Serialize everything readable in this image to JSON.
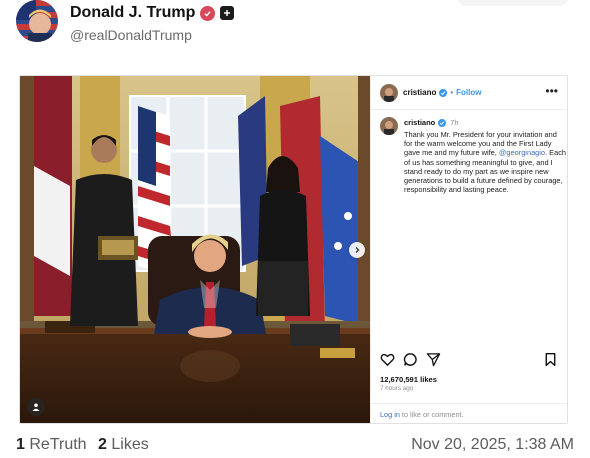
{
  "post": {
    "display_name": "Donald J. Trump",
    "handle": "@realDonaldTrump",
    "verified_icon": "verified-badge-icon",
    "extra_icon": "plus-square-icon"
  },
  "embed": {
    "username": "cristiano",
    "follow_label": "Follow",
    "dot": "•",
    "more_label": "•••",
    "caption_user": "cristiano",
    "caption_time": "7h",
    "caption_text_before": "Thank you Mr. President for your invitation and for the warm welcome you and the First Lady gave me and my future wife, ",
    "caption_mention": "@georginagio",
    "caption_text_after": ". Each of us has something meaningful to give, and I stand ready to do my part as we inspire new generations to build a future defined by courage, responsibility and lasting peace.",
    "likes": "12,670,591 likes",
    "time_ago": "7 hours ago",
    "login_link": "Log in",
    "login_rest": " to like or comment."
  },
  "footer": {
    "retruth_count": "1",
    "retruth_label": "ReTruth",
    "likes_count": "2",
    "likes_label": "Likes",
    "timestamp": "Nov 20, 2025, 1:38 AM"
  },
  "colors": {
    "verified": "#d9475b",
    "link": "#3797ef",
    "text_muted": "#6b6b6b"
  }
}
